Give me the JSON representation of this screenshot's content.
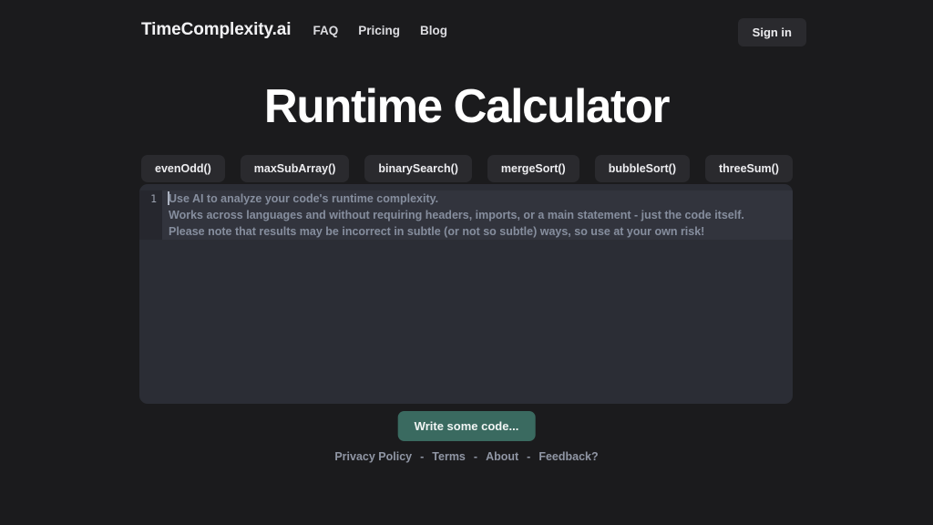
{
  "header": {
    "brand": "TimeComplexity.ai",
    "nav": [
      {
        "label": "FAQ"
      },
      {
        "label": "Pricing"
      },
      {
        "label": "Blog"
      }
    ],
    "signin_label": "Sign in"
  },
  "main": {
    "title": "Runtime Calculator",
    "examples": [
      {
        "label": "evenOdd()"
      },
      {
        "label": "maxSubArray()"
      },
      {
        "label": "binarySearch()"
      },
      {
        "label": "mergeSort()"
      },
      {
        "label": "bubbleSort()"
      },
      {
        "label": "threeSum()"
      }
    ],
    "editor": {
      "line_number": "1",
      "value": "",
      "placeholder": "Use AI to analyze your code's runtime complexity.\nWorks across languages and without requiring headers, imports, or a main statement - just the code itself.\nPlease note that results may be incorrect in subtle (or not so subtle) ways, so use at your own risk!"
    },
    "submit_label": "Write some code..."
  },
  "footer": {
    "links": [
      {
        "label": "Privacy Policy"
      },
      {
        "label": "Terms"
      },
      {
        "label": "About"
      },
      {
        "label": "Feedback?"
      }
    ],
    "separator": "-"
  },
  "colors": {
    "page_background": "#1b1b1d",
    "editor_background": "#2b2d35",
    "chip_background": "#2a2a2e",
    "submit_accent": "#3a6a60",
    "placeholder_text": "#868e9e",
    "footer_text": "#9096a4"
  }
}
